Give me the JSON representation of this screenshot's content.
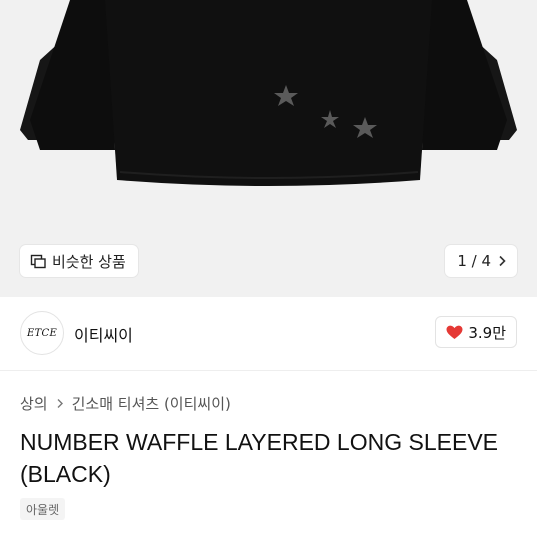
{
  "product_image": {
    "similar_button_label": "비슷한 상품",
    "similar_icon": "similar-products-icon",
    "pager_text": "1 / 4",
    "pager_icon": "chevron-right-icon"
  },
  "brand": {
    "logo_text": "ETCE",
    "name": "이티씨이",
    "like_icon": "heart-icon",
    "like_count": "3.9만",
    "like_color": "#e53935"
  },
  "breadcrumb": {
    "items": [
      "상의",
      "긴소매 티셔츠 (이티씨이)"
    ],
    "separator_icon": "chevron-right-icon"
  },
  "product": {
    "title": "NUMBER WAFFLE LAYERED LONG SLEEVE (BLACK)",
    "tag": "아울렛"
  }
}
